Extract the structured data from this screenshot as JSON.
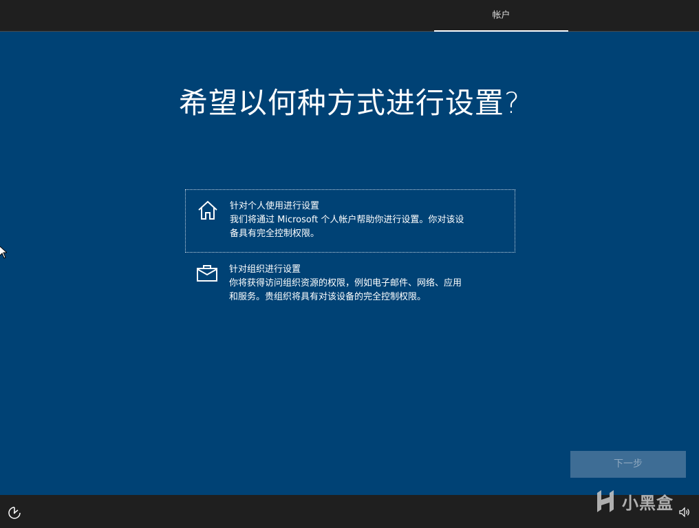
{
  "header": {
    "tab_label": "帐户"
  },
  "page": {
    "title": "希望以何种方式进行设置?"
  },
  "options": [
    {
      "icon": "home-icon",
      "title": "针对个人使用进行设置",
      "description_line1": "我们将通过 Microsoft 个人帐户帮助你进行设置。你对该设",
      "description_line2": "备具有完全控制权限。",
      "selected": true
    },
    {
      "icon": "briefcase-icon",
      "title": "针对组织进行设置",
      "description_line1": "你将获得访问组织资源的权限，例如电子邮件、网络、应用",
      "description_line2": "和服务。贵组织将具有对该设备的完全控制权限。",
      "selected": false
    }
  ],
  "footer": {
    "next_label": "下一步",
    "watermark_text": "小黑盒"
  },
  "colors": {
    "background": "#004275",
    "topbar": "#1f1f1f",
    "next_button_disabled": "#3e6d95"
  }
}
